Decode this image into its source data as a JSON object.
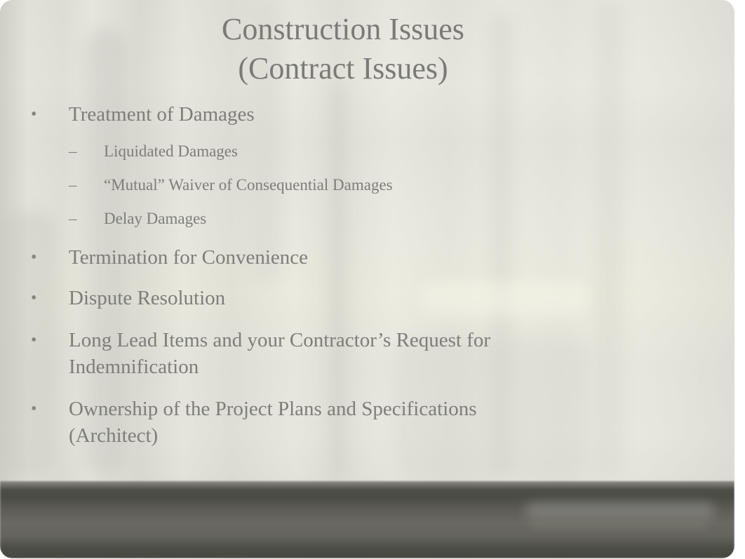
{
  "slide": {
    "title_lines": [
      "Construction Issues",
      "(Contract Issues)"
    ],
    "bullet_glyph": "•",
    "sub_bullet_glyph": "–",
    "items": [
      {
        "text": "Treatment of Damages",
        "sub_items": [
          "Liquidated Damages",
          "“Mutual” Waiver of Consequential Damages",
          "Delay Damages"
        ]
      },
      {
        "text": "Termination for Convenience"
      },
      {
        "text": "Dispute Resolution"
      },
      {
        "text_lines": [
          "Long Lead Items and your Contractor’s Request for",
          "Indemnification"
        ]
      },
      {
        "text_lines": [
          "Ownership of the Project Plans and Specifications",
          "(Architect)"
        ]
      }
    ],
    "footer": {
      "logo_icon": "firm-logo-blurred"
    }
  },
  "colors": {
    "text": "#7d7d7b",
    "title": "#7a7a78",
    "footer_band": "#4f4f49",
    "background": "#e6e5dd"
  }
}
